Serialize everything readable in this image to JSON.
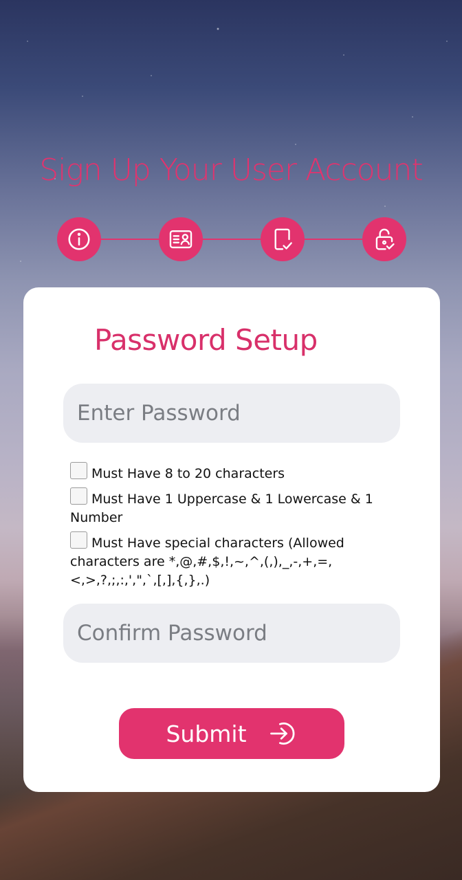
{
  "header": {
    "title": "Sign Up Your User Account"
  },
  "stepper": {
    "steps": [
      {
        "icon": "info-icon"
      },
      {
        "icon": "id-card-icon"
      },
      {
        "icon": "document-check-icon"
      },
      {
        "icon": "lock-check-icon"
      }
    ],
    "accent": "#e2336e"
  },
  "card": {
    "title": "Password Setup",
    "password": {
      "placeholder": "Enter Password",
      "value": ""
    },
    "rules": [
      "Must Have 8 to 20 characters",
      "Must Have 1 Uppercase & 1 Lowercase & 1 Number",
      "Must Have special characters (Allowed characters are *,@,#,$,!,~,^,(,),_,-,+,=,<,>,?,;,:,',\",`,[,],{,},.)"
    ],
    "confirm": {
      "placeholder": "Confirm Password",
      "value": ""
    },
    "submit_label": "Submit"
  }
}
